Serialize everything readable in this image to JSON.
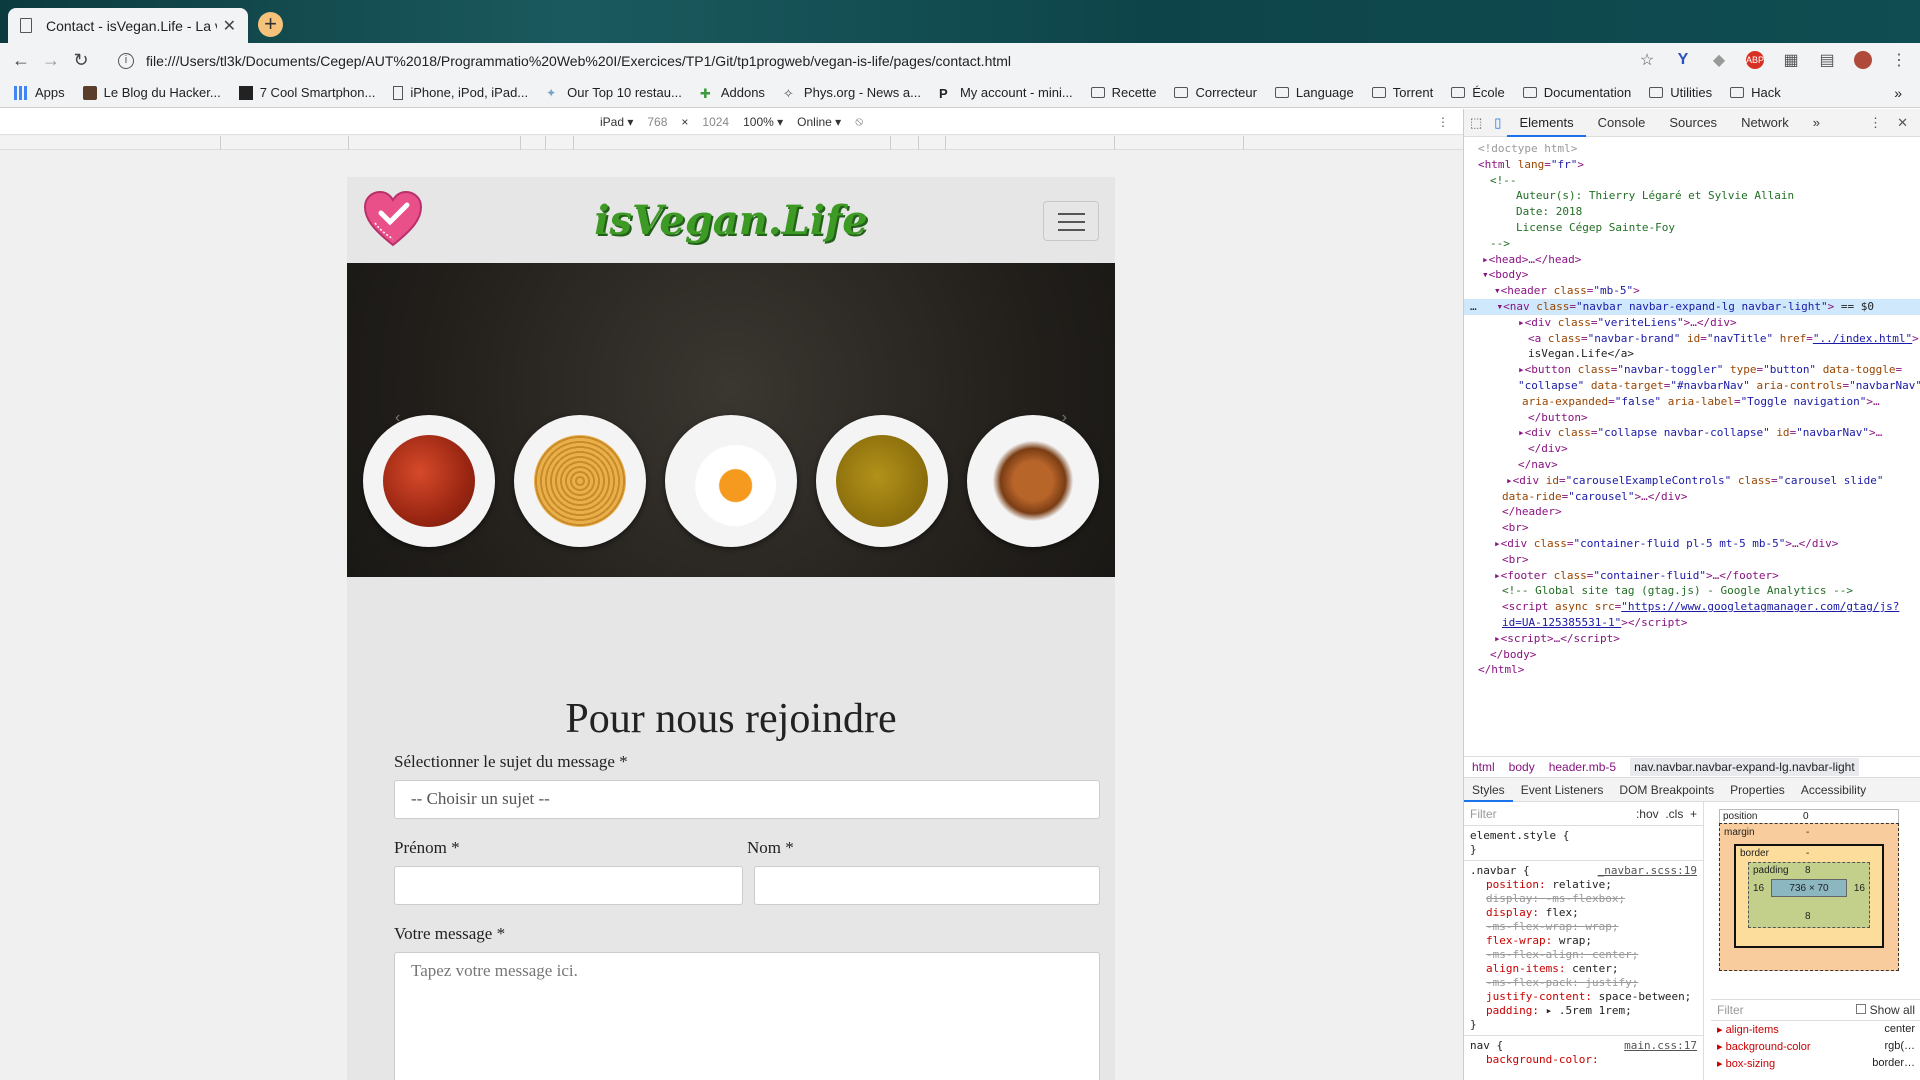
{
  "browser": {
    "tab_title": "Contact - isVegan.Life - La véri",
    "url": "file:///Users/tl3k/Documents/Cegep/AUT%2018/Programmatio%20Web%20I/Exercices/TP1/Git/tp1progweb/vegan-is-life/pages/contact.html",
    "bookmarks": [
      "Apps",
      "Le Blog du Hacker...",
      "7 Cool Smartphon...",
      "iPhone, iPod, iPad...",
      "Our Top 10 restau...",
      "Addons",
      "Phys.org - News a...",
      "My account - mini...",
      "Recette",
      "Correcteur",
      "Language",
      "Torrent",
      "École",
      "Documentation",
      "Utilities",
      "Hack"
    ]
  },
  "device_toolbar": {
    "device": "iPad ▾",
    "width": "768",
    "times": "×",
    "height": "1024",
    "zoom": "100% ▾",
    "network": "Online ▾"
  },
  "site": {
    "brand": "isVegan.Life",
    "heading": "Pour nous rejoindre",
    "subject_label": "Sélectionner le sujet du message *",
    "subject_value": "-- Choisir un sujet --",
    "firstname_label": "Prénom *",
    "lastname_label": "Nom *",
    "message_label": "Votre message *",
    "message_placeholder": "Tapez votre message ici."
  },
  "devtools": {
    "tabs": [
      "Elements",
      "Console",
      "Sources",
      "Network",
      "»"
    ],
    "breadcrumbs": [
      "html",
      "body",
      "header.mb-5",
      "nav.navbar.navbar-expand-lg.navbar-light"
    ],
    "style_tabs": [
      "Styles",
      "Event Listeners",
      "DOM Breakpoints",
      "Properties",
      "Accessibility"
    ],
    "filter": "Filter",
    "hov": ":hov",
    "cls": ".cls",
    "element_style": "element.style {",
    "close_brace": "}",
    "navbar_selector": ".navbar {",
    "navbar_source": "_navbar.scss:19",
    "nav_selector": "nav {",
    "nav_source": "main.css:17",
    "box": {
      "position_label": "position",
      "position_val": "0",
      "margin_label": "margin",
      "margin_val": "-",
      "border_label": "border",
      "border_val": "-",
      "padding_label": "padding",
      "padding_val": "8",
      "padding_side": "16",
      "content": "736 × 70"
    },
    "computed_filter": "Filter",
    "show_all": "Show all",
    "computed": [
      {
        "name": "align-items",
        "value": "center"
      },
      {
        "name": "background-color",
        "value": "rgb(…"
      },
      {
        "name": "box-sizing",
        "value": "border…"
      }
    ]
  },
  "colors": {
    "brand_green": "#3d9b25",
    "selection": "#cfe8fc",
    "devtools_tag": "#881280"
  }
}
